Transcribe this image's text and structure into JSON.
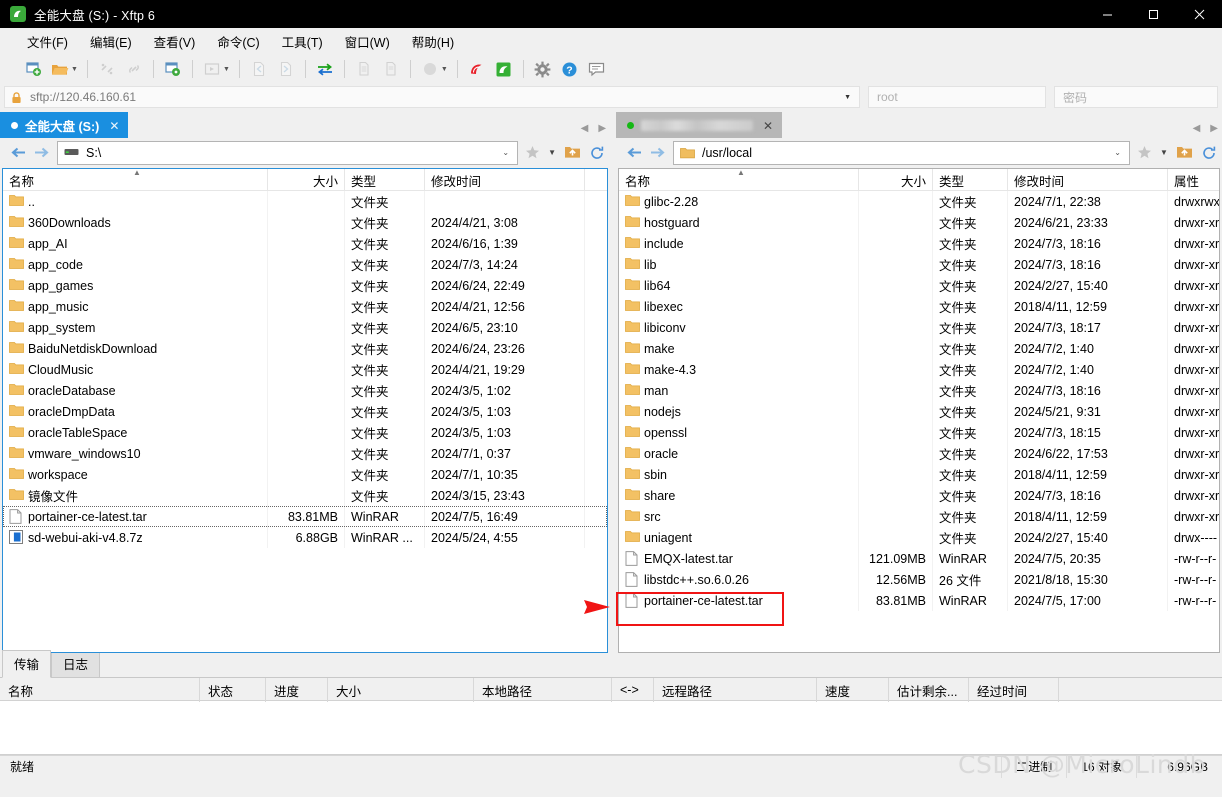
{
  "window": {
    "title": "全能大盘 (S:) - Xftp 6",
    "app_icon": "xftp-logo-icon",
    "minimize": "—",
    "maximize": "□",
    "close": "✕"
  },
  "menubar": {
    "items": [
      {
        "label": "文件(F)",
        "name": "menu-file"
      },
      {
        "label": "编辑(E)",
        "name": "menu-edit"
      },
      {
        "label": "查看(V)",
        "name": "menu-view"
      },
      {
        "label": "命令(C)",
        "name": "menu-command"
      },
      {
        "label": "工具(T)",
        "name": "menu-tools"
      },
      {
        "label": "窗口(W)",
        "name": "menu-window"
      },
      {
        "label": "帮助(H)",
        "name": "menu-help"
      }
    ]
  },
  "toolbar": {
    "items": [
      "new-session-icon",
      "open-folder-icon",
      "dropdown-caret-icon",
      "disconnect-icon",
      "link-icon",
      "session-manager-icon",
      "run-icon",
      "dropdown-caret-icon",
      "file-left-icon",
      "file-right-icon",
      "sync-transfer-icon",
      "copy-icon",
      "paste-icon",
      "circle-icon",
      "dropdown-caret-icon",
      "xshell-icon",
      "xftp-icon",
      "settings-gear-icon",
      "help-icon",
      "feedback-icon"
    ]
  },
  "address": {
    "lock_icon": "lock-icon",
    "url": "sftp://120.46.160.61",
    "dropdown": "▼",
    "username": "root",
    "password_placeholder": "密码"
  },
  "left_pane": {
    "tab": {
      "label": "全能大盘 (S:)",
      "dot": "white",
      "close": "✕"
    },
    "path": "S:\\",
    "path_icon": "drive-icon",
    "back": "←",
    "forward": "→",
    "tools": [
      "bookmark-star-icon",
      "dropdown-caret-icon",
      "parent-folder-icon",
      "refresh-icon"
    ],
    "columns": [
      "名称",
      "大小",
      "类型",
      "修改时间"
    ],
    "sort_caret": "▲",
    "rows": [
      {
        "name": "..",
        "size": "",
        "type": "文件夹",
        "time": "",
        "icon": "folder-icon"
      },
      {
        "name": "360Downloads",
        "size": "",
        "type": "文件夹",
        "time": "2024/4/21, 3:08",
        "icon": "folder-icon"
      },
      {
        "name": "app_AI",
        "size": "",
        "type": "文件夹",
        "time": "2024/6/16, 1:39",
        "icon": "folder-icon"
      },
      {
        "name": "app_code",
        "size": "",
        "type": "文件夹",
        "time": "2024/7/3, 14:24",
        "icon": "folder-icon"
      },
      {
        "name": "app_games",
        "size": "",
        "type": "文件夹",
        "time": "2024/6/24, 22:49",
        "icon": "folder-icon"
      },
      {
        "name": "app_music",
        "size": "",
        "type": "文件夹",
        "time": "2024/4/21, 12:56",
        "icon": "folder-icon"
      },
      {
        "name": "app_system",
        "size": "",
        "type": "文件夹",
        "time": "2024/6/5, 23:10",
        "icon": "folder-icon"
      },
      {
        "name": "BaiduNetdiskDownload",
        "size": "",
        "type": "文件夹",
        "time": "2024/6/24, 23:26",
        "icon": "folder-icon"
      },
      {
        "name": "CloudMusic",
        "size": "",
        "type": "文件夹",
        "time": "2024/4/21, 19:29",
        "icon": "folder-icon"
      },
      {
        "name": "oracleDatabase",
        "size": "",
        "type": "文件夹",
        "time": "2024/3/5, 1:02",
        "icon": "folder-icon"
      },
      {
        "name": "oracleDmpData",
        "size": "",
        "type": "文件夹",
        "time": "2024/3/5, 1:03",
        "icon": "folder-icon"
      },
      {
        "name": "oracleTableSpace",
        "size": "",
        "type": "文件夹",
        "time": "2024/3/5, 1:03",
        "icon": "folder-icon"
      },
      {
        "name": "vmware_windows10",
        "size": "",
        "type": "文件夹",
        "time": "2024/7/1, 0:37",
        "icon": "folder-icon"
      },
      {
        "name": "workspace",
        "size": "",
        "type": "文件夹",
        "time": "2024/7/1, 10:35",
        "icon": "folder-icon"
      },
      {
        "name": "镜像文件",
        "size": "",
        "type": "文件夹",
        "time": "2024/3/15, 23:43",
        "icon": "folder-icon"
      },
      {
        "name": "portainer-ce-latest.tar",
        "size": "83.81MB",
        "type": "WinRAR",
        "time": "2024/7/5, 16:49",
        "icon": "file-icon",
        "focused": true
      },
      {
        "name": "sd-webui-aki-v4.8.7z",
        "size": "6.88GB",
        "type": "WinRAR ...",
        "time": "2024/5/24, 4:55",
        "icon": "archive-icon"
      }
    ]
  },
  "right_pane": {
    "tab": {
      "label": "",
      "redacted": true,
      "dot": "green",
      "close": "✕"
    },
    "path": "/usr/local",
    "path_icon": "folder-icon",
    "back": "←",
    "forward": "→",
    "tools": [
      "bookmark-star-icon",
      "dropdown-caret-icon",
      "parent-folder-icon",
      "refresh-icon"
    ],
    "columns": [
      "名称",
      "大小",
      "类型",
      "修改时间",
      "属性"
    ],
    "sort_caret": "▲",
    "rows": [
      {
        "name": "glibc-2.28",
        "size": "",
        "type": "文件夹",
        "time": "2024/7/1, 22:38",
        "attr": "drwxrwxr",
        "icon": "folder-icon"
      },
      {
        "name": "hostguard",
        "size": "",
        "type": "文件夹",
        "time": "2024/6/21, 23:33",
        "attr": "drwxr-xr",
        "icon": "folder-icon"
      },
      {
        "name": "include",
        "size": "",
        "type": "文件夹",
        "time": "2024/7/3, 18:16",
        "attr": "drwxr-xr",
        "icon": "folder-icon"
      },
      {
        "name": "lib",
        "size": "",
        "type": "文件夹",
        "time": "2024/7/3, 18:16",
        "attr": "drwxr-xr",
        "icon": "folder-icon"
      },
      {
        "name": "lib64",
        "size": "",
        "type": "文件夹",
        "time": "2024/2/27, 15:40",
        "attr": "drwxr-xr",
        "icon": "folder-icon"
      },
      {
        "name": "libexec",
        "size": "",
        "type": "文件夹",
        "time": "2018/4/11, 12:59",
        "attr": "drwxr-xr",
        "icon": "folder-icon"
      },
      {
        "name": "libiconv",
        "size": "",
        "type": "文件夹",
        "time": "2024/7/3, 18:17",
        "attr": "drwxr-xr",
        "icon": "folder-icon"
      },
      {
        "name": "make",
        "size": "",
        "type": "文件夹",
        "time": "2024/7/2, 1:40",
        "attr": "drwxr-xr",
        "icon": "folder-icon"
      },
      {
        "name": "make-4.3",
        "size": "",
        "type": "文件夹",
        "time": "2024/7/2, 1:40",
        "attr": "drwxr-xr",
        "icon": "folder-icon"
      },
      {
        "name": "man",
        "size": "",
        "type": "文件夹",
        "time": "2024/7/3, 18:16",
        "attr": "drwxr-xr",
        "icon": "folder-icon"
      },
      {
        "name": "nodejs",
        "size": "",
        "type": "文件夹",
        "time": "2024/5/21, 9:31",
        "attr": "drwxr-xr",
        "icon": "folder-icon"
      },
      {
        "name": "openssl",
        "size": "",
        "type": "文件夹",
        "time": "2024/7/3, 18:15",
        "attr": "drwxr-xr",
        "icon": "folder-icon"
      },
      {
        "name": "oracle",
        "size": "",
        "type": "文件夹",
        "time": "2024/6/22, 17:53",
        "attr": "drwxr-xr",
        "icon": "folder-icon"
      },
      {
        "name": "sbin",
        "size": "",
        "type": "文件夹",
        "time": "2018/4/11, 12:59",
        "attr": "drwxr-xr",
        "icon": "folder-icon"
      },
      {
        "name": "share",
        "size": "",
        "type": "文件夹",
        "time": "2024/7/3, 18:16",
        "attr": "drwxr-xr",
        "icon": "folder-icon"
      },
      {
        "name": "src",
        "size": "",
        "type": "文件夹",
        "time": "2018/4/11, 12:59",
        "attr": "drwxr-xr",
        "icon": "folder-icon"
      },
      {
        "name": "uniagent",
        "size": "",
        "type": "文件夹",
        "time": "2024/2/27, 15:40",
        "attr": "drwx----",
        "icon": "folder-icon"
      },
      {
        "name": "EMQX-latest.tar",
        "size": "121.09MB",
        "type": "WinRAR",
        "time": "2024/7/5, 20:35",
        "attr": "-rw-r--r-",
        "icon": "file-icon"
      },
      {
        "name": "libstdc++.so.6.0.26",
        "size": "12.56MB",
        "type": "26 文件",
        "time": "2021/8/18, 15:30",
        "attr": "-rw-r--r-",
        "icon": "file-icon"
      },
      {
        "name": "portainer-ce-latest.tar",
        "size": "83.81MB",
        "type": "WinRAR",
        "time": "2024/7/5, 17:00",
        "attr": "-rw-r--r-",
        "icon": "file-icon",
        "highlighted": true
      }
    ]
  },
  "annotations": {
    "arrow_color": "#f01414",
    "box_color": "#f01414"
  },
  "transfer_panel": {
    "tabs": [
      {
        "label": "传输",
        "active": true
      },
      {
        "label": "日志",
        "active": false
      }
    ],
    "columns": [
      "名称",
      "状态",
      "进度",
      "大小",
      "本地路径",
      "<->",
      "远程路径",
      "速度",
      "估计剩余...",
      "经过时间"
    ],
    "rows": []
  },
  "statusbar": {
    "status": "就绪",
    "mode": "二进制",
    "object_count": "16 对象",
    "total_size": "6.96GB"
  },
  "watermark": "CSDN @MicroLindb"
}
